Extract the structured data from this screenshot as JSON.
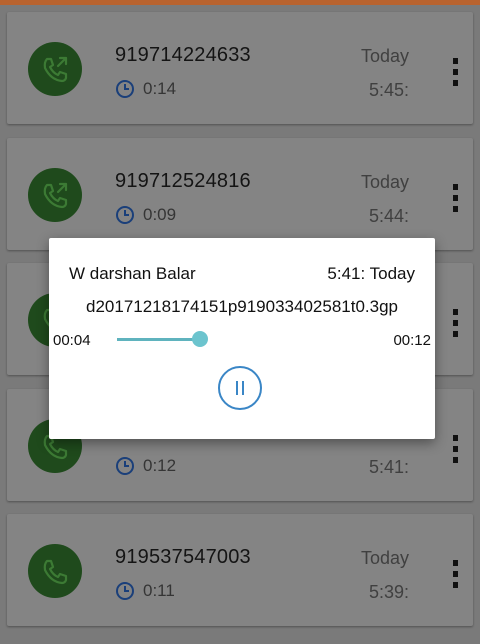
{
  "colors": {
    "accent": "#b8632f",
    "avatar_green": "#1f4a1c",
    "clock_blue": "#1a3f7a",
    "seek_teal": "#6cc4ce",
    "pause_blue": "#3a86c6"
  },
  "calls": [
    {
      "number": "919714224633",
      "duration": "0:14",
      "day": "Today",
      "time": "5:45:",
      "icon": "outgoing-call-icon"
    },
    {
      "number": "919712524816",
      "duration": "0:09",
      "day": "Today",
      "time": "5:44:",
      "icon": "outgoing-call-icon"
    },
    {
      "number": "",
      "duration": "",
      "day": "",
      "time": "",
      "icon": "phone-icon"
    },
    {
      "number": "",
      "duration": "0:12",
      "day": "",
      "time": "5:41:",
      "icon": "phone-icon"
    },
    {
      "number": "919537547003",
      "duration": "0:11",
      "day": "Today",
      "time": "5:39:",
      "icon": "phone-icon"
    }
  ],
  "player": {
    "contact": "W darshan Balar",
    "when": "5:41: Today",
    "filename": "d20171218174151p919033402581t0.3gp",
    "current_time": "00:04",
    "total_time": "00:12",
    "progress_fraction": 0.33,
    "control_icon": "pause-icon"
  }
}
